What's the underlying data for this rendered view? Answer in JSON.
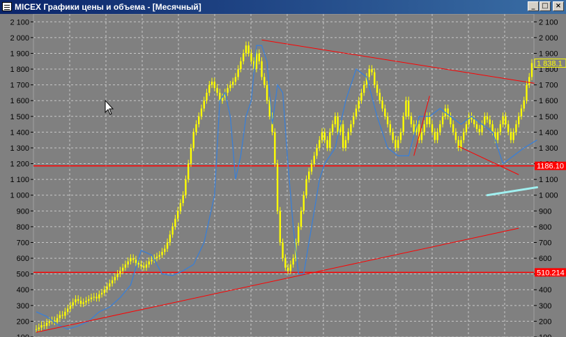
{
  "window": {
    "title": "MICEX Графики цены и объема - [Месячный]",
    "buttons": {
      "minimize": "_",
      "maximize": "□",
      "close": "×"
    }
  },
  "chart_data": {
    "type": "candlestick",
    "title": "",
    "xlabel": "",
    "ylabel": "",
    "ylim": [
      100,
      2150
    ],
    "yticks": [
      100,
      200,
      300,
      400,
      500,
      600,
      700,
      800,
      900,
      1000,
      1100,
      1200,
      1300,
      1400,
      1500,
      1600,
      1700,
      1800,
      1900,
      2000,
      2100
    ],
    "ytick_labels": [
      "100",
      "200",
      "300",
      "400",
      "500",
      "600",
      "700",
      "800",
      "900",
      "1 000",
      "1 100",
      "1 200",
      "1 300",
      "1 400",
      "1 500",
      "1 600",
      "1 700",
      "1 800",
      "1 900",
      "2 000",
      "2 100"
    ],
    "grid": true,
    "price_series": {
      "name": "",
      "color": "#ffff00",
      "close": [
        150,
        160,
        175,
        170,
        190,
        200,
        205,
        195,
        220,
        240,
        235,
        260,
        280,
        300,
        320,
        340,
        330,
        310,
        320,
        330,
        340,
        350,
        355,
        345,
        370,
        380,
        400,
        420,
        440,
        460,
        480,
        500,
        520,
        540,
        560,
        580,
        600,
        590,
        570,
        560,
        550,
        540,
        560,
        580,
        590,
        600,
        610,
        620,
        640,
        660,
        700,
        750,
        800,
        850,
        900,
        950,
        1000,
        1100,
        1200,
        1300,
        1400,
        1450,
        1500,
        1550,
        1600,
        1650,
        1700,
        1720,
        1680,
        1650,
        1600,
        1620,
        1650,
        1680,
        1700,
        1720,
        1750,
        1800,
        1850,
        1900,
        1950,
        1900,
        1850,
        1800,
        1900,
        1850,
        1750,
        1700,
        1600,
        1500,
        1400,
        1200,
        900,
        700,
        600,
        540,
        520,
        560,
        600,
        700,
        800,
        900,
        1000,
        1100,
        1150,
        1200,
        1250,
        1300,
        1350,
        1400,
        1350,
        1300,
        1400,
        1450,
        1500,
        1400,
        1450,
        1300,
        1350,
        1400,
        1450,
        1500,
        1550,
        1600,
        1650,
        1700,
        1750,
        1800,
        1780,
        1700,
        1650,
        1600,
        1550,
        1500,
        1450,
        1400,
        1350,
        1300,
        1350,
        1400,
        1500,
        1600,
        1500,
        1450,
        1400,
        1450,
        1350,
        1400,
        1450,
        1500,
        1450,
        1400,
        1350,
        1400,
        1450,
        1500,
        1550,
        1500,
        1450,
        1400,
        1350,
        1300,
        1350,
        1400,
        1450,
        1500,
        1480,
        1450,
        1420,
        1400,
        1450,
        1500,
        1480,
        1450,
        1400,
        1350,
        1400,
        1450,
        1500,
        1450,
        1400,
        1350,
        1400,
        1450,
        1500,
        1550,
        1600,
        1700,
        1750,
        1838.1
      ]
    },
    "envelope_series": {
      "name": "",
      "color": "#3a7fd6",
      "x": [
        0,
        4,
        8,
        12,
        16,
        20,
        24,
        28,
        32,
        36,
        40,
        44,
        48,
        52,
        56,
        60,
        64,
        68,
        70,
        72,
        74,
        76,
        78,
        80,
        82,
        84,
        86,
        88,
        90,
        92,
        94,
        96,
        98,
        100,
        102,
        104,
        106,
        108,
        110,
        114,
        118,
        122,
        126,
        130,
        134,
        138,
        142,
        146,
        150,
        154,
        158,
        162,
        166,
        170,
        174,
        178,
        182,
        186,
        191
      ],
      "values": [
        260,
        230,
        180,
        150,
        170,
        200,
        260,
        290,
        350,
        430,
        650,
        620,
        500,
        490,
        520,
        560,
        700,
        1000,
        1600,
        1650,
        1500,
        1100,
        1250,
        1500,
        1600,
        1950,
        1950,
        1850,
        1450,
        1700,
        1650,
        1200,
        800,
        500,
        500,
        700,
        900,
        1100,
        1200,
        1300,
        1600,
        1800,
        1750,
        1500,
        1300,
        1250,
        1250,
        1500,
        1500,
        1550,
        1500,
        1450,
        1500,
        1450,
        1400,
        1200,
        1250,
        1300,
        1350
      ]
    },
    "horizontal_lines": [
      {
        "y": 1186.1,
        "label": "1186.10",
        "color": "#ff0000"
      },
      {
        "y": 510.214,
        "label": "510.214",
        "color": "#ff0000"
      }
    ],
    "last_value": {
      "y": 1838.1,
      "label": "1 838.1"
    },
    "trend_lines": [
      {
        "color": "#ff0000",
        "x": [
          0,
          184
        ],
        "y": [
          130,
          790
        ]
      },
      {
        "color": "#ff0000",
        "x": [
          86,
          190
        ],
        "y": [
          1985,
          1710
        ]
      },
      {
        "color": "#ff0000",
        "x": [
          144,
          150
        ],
        "y": [
          1250,
          1630
        ]
      },
      {
        "color": "#ff0000",
        "x": [
          161,
          184
        ],
        "y": [
          1310,
          1130
        ]
      }
    ],
    "highlight_segment": {
      "color": "#a0f0f0",
      "x": [
        172,
        191
      ],
      "y": [
        1000,
        1050
      ]
    }
  }
}
